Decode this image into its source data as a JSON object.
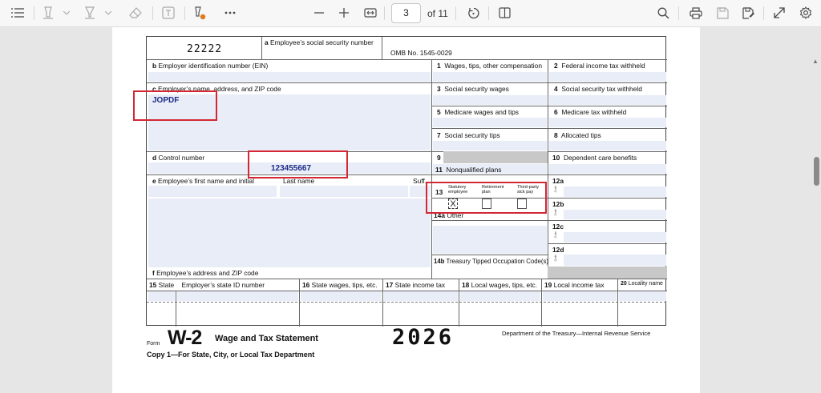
{
  "toolbar": {
    "page_number": "3",
    "page_of": "of 11",
    "icons": [
      "contents-icon",
      "highlight-icon",
      "draw-icon",
      "erase-icon",
      "text-box-icon",
      "sign-icon",
      "more-icon",
      "zoom-out-icon",
      "zoom-in-icon",
      "fit-width-icon",
      "rotate-icon",
      "page-view-icon",
      "search-icon",
      "print-icon",
      "save-icon",
      "save-as-icon",
      "expand-icon",
      "settings-icon"
    ]
  },
  "form": {
    "ssn_code": "22222",
    "ssn_label_a": "a",
    "ssn_label": "Employee’s social security number",
    "omb": "OMB No. 1545-0029",
    "ein_label": "Employer identification number (EIN)",
    "ein_letter": "b",
    "employer_label": "Employer’s name, address, and ZIP code",
    "employer_letter": "c",
    "employer_value": "JOPDF",
    "control_letter": "d",
    "control_label": "Control number",
    "control_value": "123455667",
    "emp_first_letter": "e",
    "emp_first_label": "Employee’s first name and initial",
    "last_name_label": "Last name",
    "suff_label": "Suff.",
    "emp_addr_letter": "f",
    "emp_addr_label": "Employee’s address and ZIP code",
    "box1": "1",
    "box1_label": "Wages, tips, other compensation",
    "box2": "2",
    "box2_label": "Federal income tax withheld",
    "box3": "3",
    "box3_label": "Social security wages",
    "box4": "4",
    "box4_label": "Social security tax withheld",
    "box5": "5",
    "box5_label": "Medicare wages and tips",
    "box6": "6",
    "box6_label": "Medicare tax withheld",
    "box7": "7",
    "box7_label": "Social security tips",
    "box8": "8",
    "box8_label": "Allocated tips",
    "box9": "9",
    "box10": "10",
    "box10_label": "Dependent care benefits",
    "box11": "11",
    "box11_label": "Nonqualified plans",
    "box12a": "12a",
    "box12b": "12b",
    "box12c": "12c",
    "box12d": "12d",
    "box13": "13",
    "statutory": "Statutory employee",
    "retirement": "Retirement plan",
    "thirdparty": "Third-party sick pay",
    "statutory_checked": "X",
    "box14a": "14a",
    "box14a_label": "Other",
    "box14b": "14b",
    "box14b_label": "Treasury Tipped Occupation Code(s)",
    "box15": "15",
    "box15_label": "State",
    "box15_label2": "Employer’s state ID number",
    "box16": "16",
    "box16_label": "State wages, tips, etc.",
    "box17": "17",
    "box17_label": "State income tax",
    "box18": "18",
    "box18_label": "Local wages, tips, etc.",
    "box19": "19",
    "box19_label": "Local income tax",
    "box20": "20",
    "box20_label": "Locality name",
    "code_label": "Code"
  },
  "footer": {
    "form_word": "Form",
    "title_w2": "W-2",
    "title": "Wage and Tax Statement",
    "year": "2026",
    "dept": "Department of the Treasury—Internal Revenue Service",
    "copy": "Copy 1—For State, City, or Local Tax Department"
  },
  "colors": {
    "annotation_red": "#d32734",
    "value_blue": "#1c2a86"
  }
}
